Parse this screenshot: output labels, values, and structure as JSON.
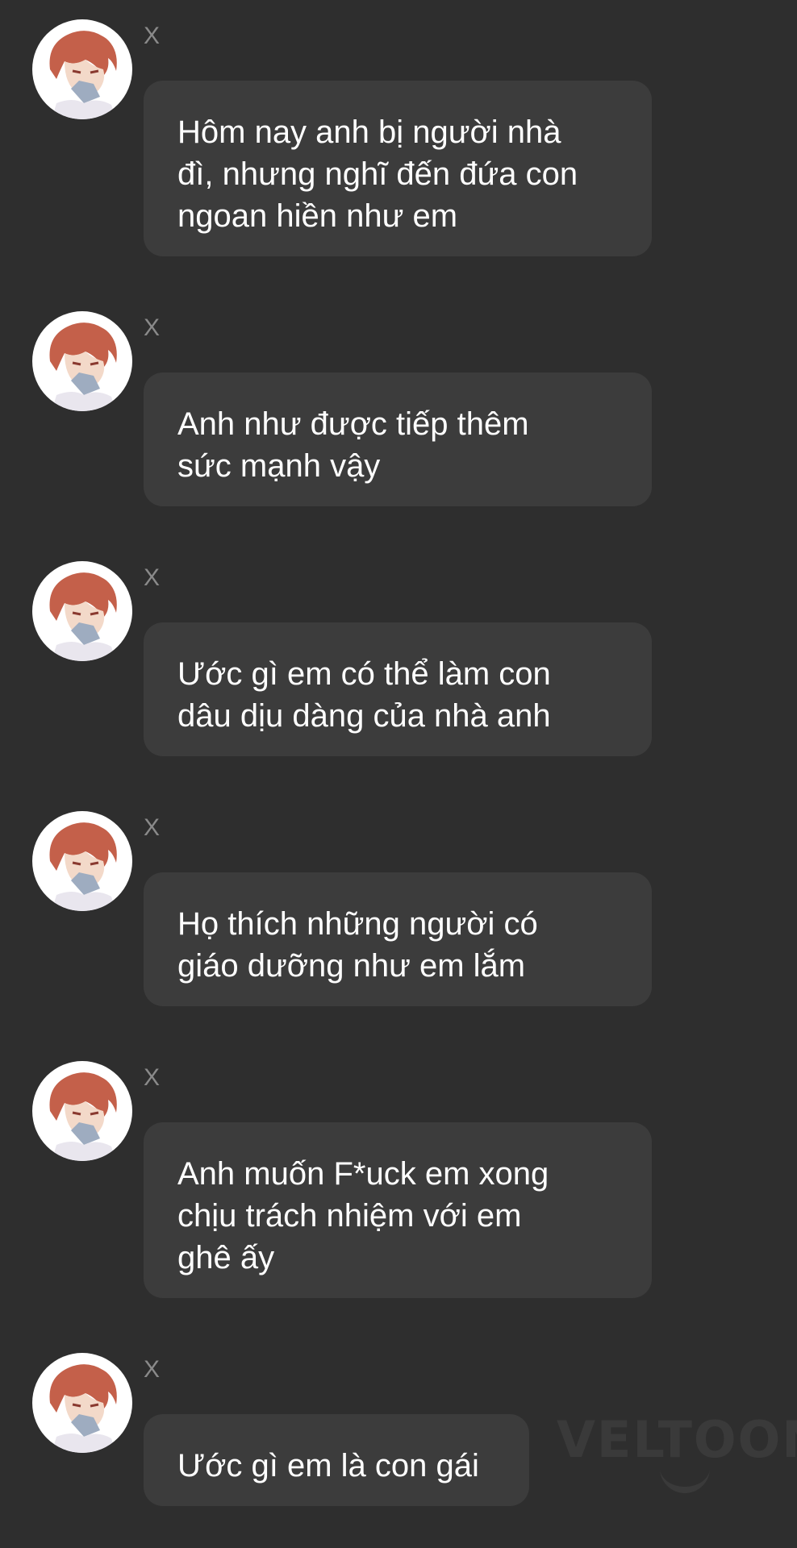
{
  "messages": [
    {
      "sender": "X",
      "text": "Hôm nay anh bị người nhà\nđì, nhưng nghĩ đến đứa con\nngoan hiền như em"
    },
    {
      "sender": "X",
      "text": "Anh như được tiếp thêm\nsức mạnh vậy"
    },
    {
      "sender": "X",
      "text": "Ước gì em có thể làm con\ndâu dịu dàng của nhà anh"
    },
    {
      "sender": "X",
      "text": "Họ thích những người có\ngiáo dưỡng như em lắm"
    },
    {
      "sender": "X",
      "text": "Anh muốn F*uck em xong\nchịu trách nhiệm với em\nghê ấy"
    },
    {
      "sender": "X",
      "text": "Ước gì em là con gái"
    }
  ],
  "watermark": "VELTOON",
  "colors": {
    "background": "#2e2e2e",
    "bubble": "#3c3c3c",
    "text": "#ffffff",
    "sender": "#8a8a8a"
  }
}
